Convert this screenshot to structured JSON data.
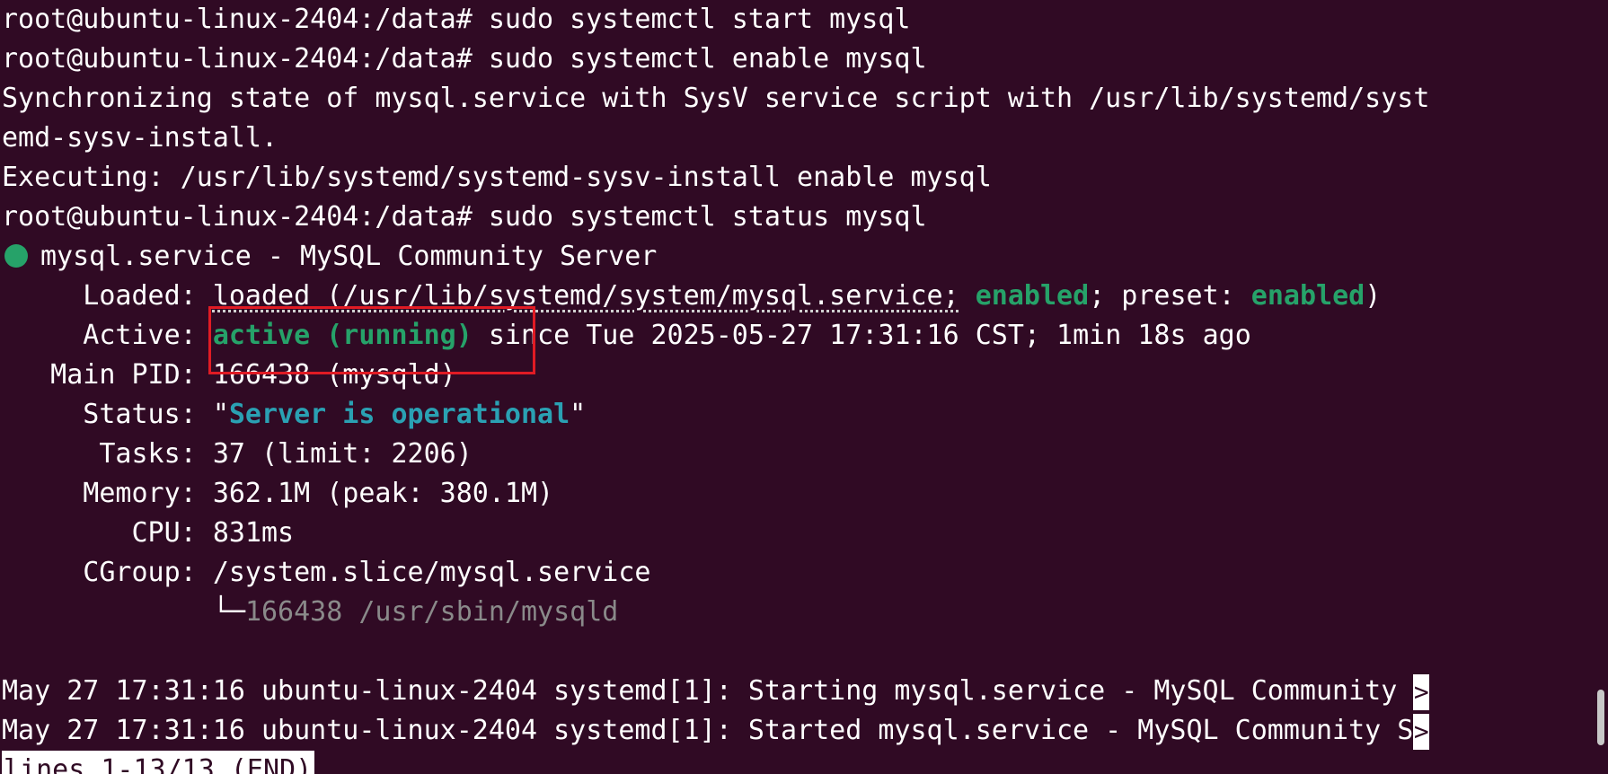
{
  "terminal": {
    "bg_color": "#300a24",
    "accent_green": "#26a269",
    "accent_teal": "#2aa1b3",
    "lines": {
      "l1": "root@ubuntu-linux-2404:/data# sudo systemctl start mysql",
      "l2": "root@ubuntu-linux-2404:/data# sudo systemctl enable mysql",
      "l3": "Synchronizing state of mysql.service with SysV service script with /usr/lib/systemd/syst",
      "l4": "emd-sysv-install.",
      "l5": "Executing: /usr/lib/systemd/systemd-sysv-install enable mysql",
      "l6": "root@ubuntu-linux-2404:/data# sudo systemctl status mysql",
      "l7": "mysql.service - MySQL Community Server"
    },
    "status": {
      "loaded_key": "     Loaded: ",
      "loaded_path": "loaded (/usr/lib/systemd/system/mysql.service;",
      "loaded_enabled": "enabled",
      "loaded_mid": "; preset: ",
      "loaded_preset": "enabled",
      "loaded_end": ")",
      "active_key": "     Active: ",
      "active_state": "active (running)",
      "active_since": " since Tue 2025-05-27 17:31:16 CST; 1min 18s ago",
      "pid_key": "   Main PID: ",
      "pid_val": "166438 (mysqld)",
      "status_key": "     Status: ",
      "status_quote_open": "\"",
      "status_val": "Server is operational",
      "status_quote_close": "\"",
      "tasks_key": "      Tasks: ",
      "tasks_val": "37 (limit: 2206)",
      "memory_key": "     Memory: ",
      "memory_val": "362.1M (peak: 380.1M)",
      "cpu_key": "        CPU: ",
      "cpu_val": "831ms",
      "cgroup_key": "     CGroup: ",
      "cgroup_val": "/system.slice/mysql.service",
      "tree_prefix": "             └─",
      "tree_val": "166438 /usr/sbin/mysqld"
    },
    "journal": {
      "j1": "May 27 17:31:16 ubuntu-linux-2404 systemd[1]: Starting mysql.service - MySQL Community ",
      "j2": "May 27 17:31:16 ubuntu-linux-2404 systemd[1]: Started mysql.service - MySQL Community S",
      "trunc": ">"
    },
    "pager": "lines 1-13/13 (END)"
  }
}
